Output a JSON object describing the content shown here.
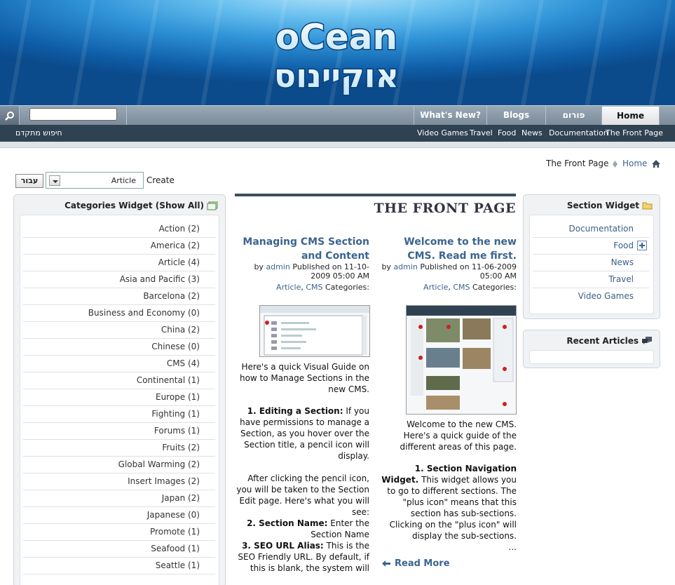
{
  "logo": {
    "top_text": "oCean",
    "bottom_text": "אוקיינוס"
  },
  "nav": {
    "tabs": [
      "Home",
      "פורום",
      "Blogs",
      "What's New?"
    ]
  },
  "subnav": {
    "links": [
      "The Front Page",
      "Documentation",
      "News",
      "Food",
      "Travel",
      "Video Games"
    ],
    "advanced_search": "חיפוש מתקדם"
  },
  "breadcrumb": {
    "home": "Home",
    "current": "The Front Page"
  },
  "create": {
    "go_label": "עבור",
    "selected": "Article",
    "label": "Create"
  },
  "categories_widget": {
    "title": "Categories Widget (Show All)",
    "items": [
      "Action (2)",
      "America (2)",
      "Article (4)",
      "Asia and Pacific (3)",
      "Barcelona (2)",
      "Business and Economy (0)",
      "China (2)",
      "Chinese (0)",
      "CMS (4)",
      "Continental (1)",
      "Europe (1)",
      "Fighting (1)",
      "Forums (1)",
      "Fruits (2)",
      "Global Warming (2)",
      "Insert Images (2)",
      "Japan (2)",
      "Japanese (0)",
      "Promote (1)",
      "Seafood (1)",
      "Seattle (1)"
    ]
  },
  "section_widget": {
    "title": "Section Widget",
    "items": [
      "Documentation",
      "Food",
      "News",
      "Travel",
      "Video Games"
    ]
  },
  "recent_articles": {
    "title": "Recent Articles"
  },
  "front_page": {
    "title": "THE FRONT PAGE"
  },
  "article1": {
    "title": "Welcome to the new CMS. Read me first.",
    "by": "by",
    "author": "admin",
    "published": "Published on 11-06-2009 05:00 AM",
    "categories_label": "Categories:",
    "cat1": "Article",
    "cat2": "CMS",
    "intro": "Welcome to the new CMS. Here's a quick guide of the different areas of this page.",
    "p1_head": "1. Section Navigation Widget.",
    "p1": "This widget allows you to go to different sections. The \"plus icon\" means that this section has sub-sections. Clicking on the \"plus icon\" will display the sub-sections.",
    "ellipsis": "...",
    "read_more": "Read More"
  },
  "article2": {
    "title": "Managing CMS Section and Content",
    "by": "by",
    "author": "admin",
    "published": "Published on 11-10-2009 05:00 AM",
    "categories_label": "Categories:",
    "cat1": "Article",
    "cat2": "CMS",
    "intro": "Here's a quick Visual Guide on how to Manage Sections in the new CMS.",
    "p1_head": "1. Editing a Section:",
    "p1": "If you have permissions to manage a Section, as you hover over the Section title, a pencil icon will display.",
    "p2": "After clicking the pencil icon, you will be taken to the Section Edit page. Here's what you will see:",
    "p3_head": "2. Section Name:",
    "p3": "Enter the Section Name",
    "p4_head": "3. SEO URL Alias:",
    "p4": "This is the SEO Friendly URL. By default, if this is blank, the system will"
  },
  "colors": {
    "link": "#3b6490",
    "nav": "#8a98a6",
    "subnav": "#2f4252"
  }
}
